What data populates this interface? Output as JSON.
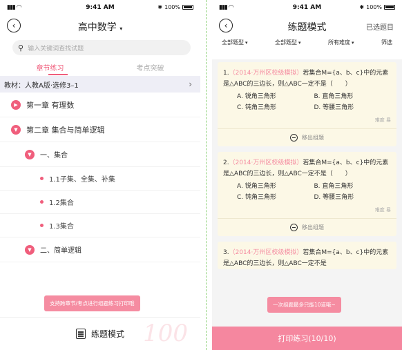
{
  "status": {
    "time": "9:41 AM",
    "battery": "100%"
  },
  "left": {
    "title": "高中数学",
    "search_placeholder": "输入关键词查找试题",
    "tabs": [
      "章节练习",
      "考点突破"
    ],
    "textbook": "教材：人教A版·选修3–1",
    "tree": [
      {
        "level": 1,
        "label": "第一章 有理数"
      },
      {
        "level": 1,
        "label": "第二章 集合与简单逻辑"
      },
      {
        "level": 2,
        "label": "一、集合"
      },
      {
        "level": 3,
        "label": "1.1子集、全集、补集"
      },
      {
        "level": 3,
        "label": "1.2集合"
      },
      {
        "level": 3,
        "label": "1.3集合"
      },
      {
        "level": 2,
        "label": "二、简单逻辑"
      }
    ],
    "tooltip": "支持跨章节/考点进行组题练习打印哦",
    "bottom_label": "练题模式",
    "watermark": "100"
  },
  "right": {
    "title": "练题模式",
    "selected_label": "已选题目",
    "filters": [
      "全部题型",
      "全部题型",
      "所有难度",
      "筛选"
    ],
    "questions": [
      {
        "num": "1.",
        "source": "（2014·万州区校级模拟）",
        "text_a": "若集合M={a、b、c}中的元素是△ABC的三边长，则△ABC一定不是（　　）",
        "options": [
          "A. 锐角三角形",
          "B. 直角三角形",
          "C. 钝角三角形",
          "D. 等腰三角形"
        ],
        "difficulty": "难度 易",
        "remove_label": "移出组题"
      },
      {
        "num": "2.",
        "source": "（2014·万州区校级模拟）",
        "text_a": "若集合M={a、b、c}中的元素是△ABC的三边长，则△ABC一定不是（　　）",
        "options": [
          "A. 锐角三角形",
          "B. 直角三角形",
          "C. 钝角三角形",
          "D. 等腰三角形"
        ],
        "difficulty": "难度 易",
        "remove_label": "移出组题"
      },
      {
        "num": "3.",
        "source": "（2014·万州区校级模拟）",
        "text_a": "若集合M={a、b、c}中的元素是△ABC的三边长，则△ABC一定不是",
        "options": [],
        "difficulty": "",
        "remove_label": ""
      }
    ],
    "tooltip": "一次组题最多只能10道哦~",
    "print_label": "打印练习(10/10)"
  },
  "colors": {
    "accent": "#f05e7c",
    "card_bg": "#fcf8e6",
    "print_bar": "#f5879f"
  }
}
